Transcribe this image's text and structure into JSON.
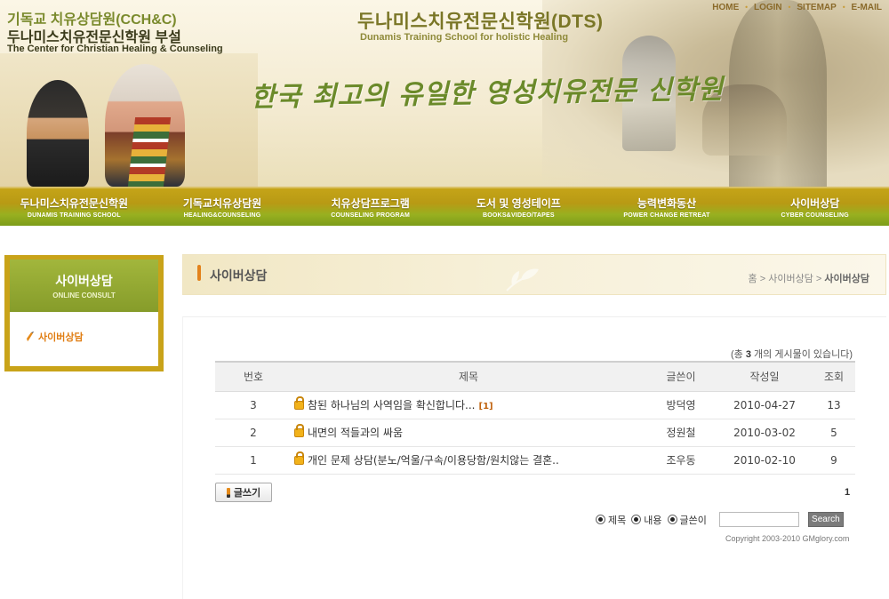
{
  "header": {
    "org_name_ko": "기독교 치유상담원(CCH&C)",
    "org_sub_ko": "두나미스치유전문신학원 부설",
    "org_name_en": "The Center for Christian Healing & Counseling",
    "school_name_ko": "두나미스치유전문신학원(DTS)",
    "school_name_en": "Dunamis Training School for holistic Healing",
    "slogan": "한국 최고의 유일한 영성치유전문 신학원"
  },
  "util_nav": [
    "HOME",
    "LOGIN",
    "SITEMAP",
    "E-MAIL"
  ],
  "main_nav": [
    {
      "ko": "두나미스치유전문신학원",
      "en": "DUNAMIS TRAINING SCHOOL"
    },
    {
      "ko": "기독교치유상담원",
      "en": "HEALING&COUNSELING"
    },
    {
      "ko": "치유상담프로그램",
      "en": "COUNSELING PROGRAM"
    },
    {
      "ko": "도서 및 영성테이프",
      "en": "BOOKS&VIDEO/TAPES"
    },
    {
      "ko": "능력변화동산",
      "en": "POWER CHANGE RETREAT"
    },
    {
      "ko": "사이버상담",
      "en": "CYBER COUNSELING"
    }
  ],
  "sidebar": {
    "title_ko": "사이버상담",
    "title_en": "ONLINE CONSULT",
    "items": [
      "사이버상담"
    ]
  },
  "page": {
    "title": "사이버상담",
    "breadcrumb": {
      "home": "홈",
      "sep": ">",
      "section": "사이버상담",
      "current": "사이버상담"
    }
  },
  "board": {
    "total_prefix": "(총",
    "total_count": "3",
    "total_suffix": "개의 게시물이 있습니다)",
    "columns": [
      "번호",
      "제목",
      "글쓴이",
      "작성일",
      "조회"
    ],
    "rows": [
      {
        "num": "3",
        "title": "참된 하나님의 사역임을 확신합니다...",
        "comments": "[1]",
        "author": "방덕영",
        "date": "2010-04-27",
        "views": "13"
      },
      {
        "num": "2",
        "title": "내면의 적들과의 싸움",
        "comments": "",
        "author": "정원철",
        "date": "2010-03-02",
        "views": "5"
      },
      {
        "num": "1",
        "title": "개인 문제 상담(분노/억울/구속/이용당함/원치않는 결혼..",
        "comments": "",
        "author": "조우동",
        "date": "2010-02-10",
        "views": "9"
      }
    ],
    "write_label": "글쓰기",
    "page_number": "1"
  },
  "search": {
    "options": [
      {
        "label": "제목",
        "checked": true
      },
      {
        "label": "내용",
        "checked": true
      },
      {
        "label": "글쓴이",
        "checked": true
      }
    ],
    "query": "",
    "button_label": "Search"
  },
  "footer": {
    "copyright": "Copyright 2003-2010 GMglory.com"
  },
  "colors": {
    "accent_green": "#869c2a",
    "accent_gold": "#c9a319",
    "accent_orange": "#e3821c",
    "author_blue": "#1f5c96"
  }
}
